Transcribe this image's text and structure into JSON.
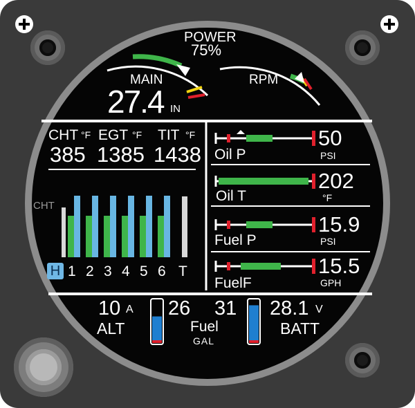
{
  "manifold": {
    "title": "MAIN",
    "value": "27.4",
    "unit": "IN"
  },
  "power": {
    "title": "POWER",
    "value": "75%"
  },
  "rpm": {
    "title": "RPM"
  },
  "temps": {
    "cht_label": "CHT",
    "egt_label": "EGT",
    "tit_label": "TIT",
    "unit": "°F",
    "cht_value": "385",
    "egt_value": "1385",
    "tit_value": "1438"
  },
  "bargraph": {
    "axis_label": "CHT",
    "cylinders": [
      "1",
      "2",
      "3",
      "4",
      "5",
      "6"
    ],
    "hot_label": "H",
    "turbo_label": "T",
    "egt_fraction": [
      0.89,
      0.89,
      0.89,
      0.89,
      0.89,
      0.89
    ],
    "cht_fraction": [
      0.6,
      0.6,
      0.6,
      0.6,
      0.6,
      0.6
    ]
  },
  "oil_p": {
    "label": "Oil P",
    "value": "50",
    "unit": "PSI"
  },
  "oil_t": {
    "label": "Oil  T",
    "value": "202",
    "unit": "°F"
  },
  "fuel_p": {
    "label": "Fuel P",
    "value": "15.9",
    "unit": "PSI"
  },
  "fuel_f": {
    "label": "FuelF",
    "value": "15.5",
    "unit": "GPH"
  },
  "alt": {
    "label": "ALT",
    "value": "10",
    "unit": "A"
  },
  "fuel": {
    "label": "Fuel",
    "unit": "GAL",
    "left": "26",
    "right": "31",
    "left_level": 0.62,
    "right_level": 0.88
  },
  "batt": {
    "label": "BATT",
    "value": "28.1",
    "unit": "V"
  },
  "colors": {
    "green": "#3fb54a",
    "blue": "#68b6e3",
    "red": "#e0202c",
    "yellow": "#f2d40f",
    "white": "#ffffff",
    "tank_blue": "#1f7fd0"
  }
}
